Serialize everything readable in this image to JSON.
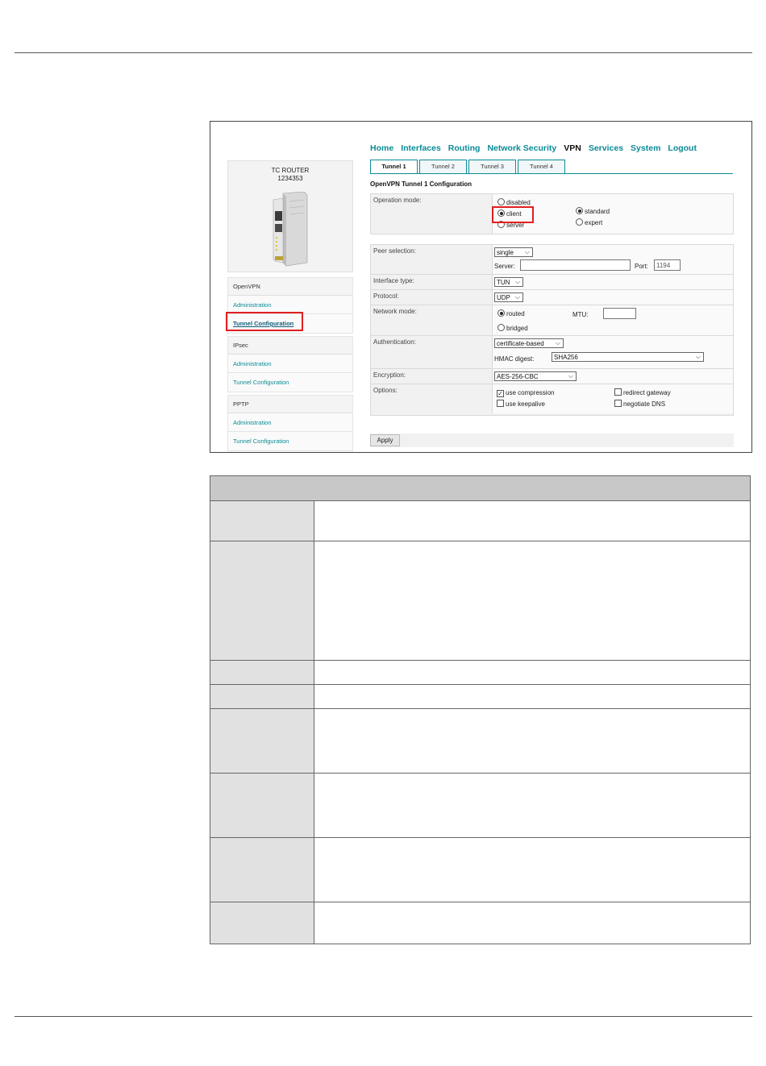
{
  "device": {
    "title": "TC ROUTER",
    "id": "1234353"
  },
  "sidebar": [
    {
      "heading": "OpenVPN",
      "items": [
        {
          "label": "Administration",
          "active": false
        },
        {
          "label": "Tunnel Configuration",
          "active": true
        }
      ]
    },
    {
      "heading": "IPsec",
      "items": [
        {
          "label": "Administration",
          "active": false
        },
        {
          "label": "Tunnel Configuration",
          "active": false
        }
      ]
    },
    {
      "heading": "PPTP",
      "items": [
        {
          "label": "Administration",
          "active": false
        },
        {
          "label": "Tunnel Configuration",
          "active": false
        }
      ]
    }
  ],
  "nav": [
    "Home",
    "Interfaces",
    "Routing",
    "Network Security",
    "VPN",
    "Services",
    "System",
    "Logout"
  ],
  "nav_active": "VPN",
  "tabs": [
    "Tunnel 1",
    "Tunnel 2",
    "Tunnel 3",
    "Tunnel 4"
  ],
  "tab_active": "Tunnel 1",
  "section_title": "OpenVPN Tunnel 1 Configuration",
  "operation": {
    "label": "Operation mode:",
    "modes": [
      "disabled",
      "client",
      "server"
    ],
    "selected_mode": "client",
    "variants": [
      "standard",
      "expert"
    ],
    "selected_variant": "standard"
  },
  "peer": {
    "label": "Peer selection:",
    "value": "single",
    "server_label": "Server:",
    "server_value": "",
    "port_label": "Port:",
    "port_value": "1194"
  },
  "interface_type": {
    "label": "Interface type:",
    "value": "TUN"
  },
  "protocol": {
    "label": "Protocol:",
    "value": "UDP"
  },
  "network_mode": {
    "label": "Network mode:",
    "options": [
      "routed",
      "bridged"
    ],
    "selected": "routed",
    "mtu_label": "MTU:",
    "mtu_value": ""
  },
  "authentication": {
    "label": "Authentication:",
    "value": "certificate-based",
    "hmac_label": "HMAC digest:",
    "hmac_value": "SHA256"
  },
  "encryption": {
    "label": "Encryption:",
    "value": "AES-256-CBC"
  },
  "options": {
    "label": "Options:",
    "items": [
      {
        "label": "use compression",
        "checked": true
      },
      {
        "label": "use keepalive",
        "checked": false
      },
      {
        "label": "redirect gateway",
        "checked": false
      },
      {
        "label": "negotiate DNS",
        "checked": false
      }
    ]
  },
  "apply_label": "Apply"
}
